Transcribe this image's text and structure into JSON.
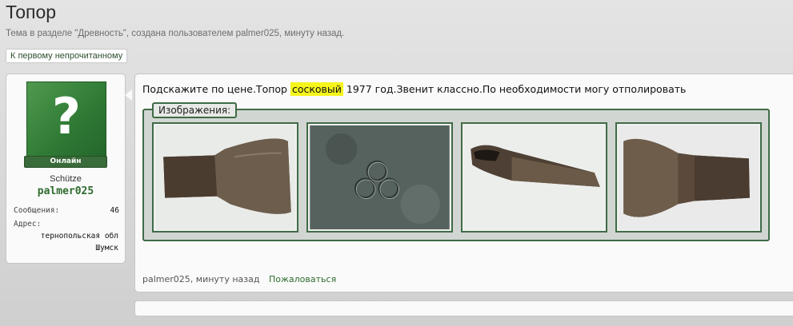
{
  "thread": {
    "title": "Топор",
    "subtitle": "Тема в разделе \"Древность\", создана пользователем palmer025, минуту назад.",
    "unread_button": "К первому непрочитанному"
  },
  "user": {
    "avatar_glyph": "?",
    "online_label": "Онлайн",
    "rank": "Schütze",
    "name": "palmer025",
    "messages_label": "Сообщения:",
    "messages_value": "46",
    "address_label": "Адрес:",
    "address_line1": "тернопольская обл",
    "address_line2": "Шумск"
  },
  "post": {
    "text_before": "Подскажите по цене.Топор ",
    "text_highlight": "сосковый",
    "text_after": " 1977 год.Звенит классно.По необходимости могу отполировать",
    "attachments_label": "Изображения:",
    "meta": "palmer025, минуту назад",
    "report_link": "Пожаловаться"
  },
  "colors": {
    "accent_green": "#2e6b2e",
    "highlight": "#f5f51c",
    "attach_border": "#3f6b47"
  }
}
